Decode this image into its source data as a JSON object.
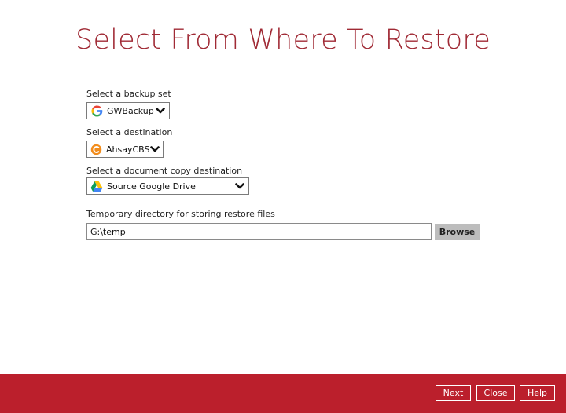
{
  "title": "Select From Where To Restore",
  "backup_set": {
    "label": "Select a backup set",
    "value": "GWBackup",
    "icon": "google-g-icon"
  },
  "destination": {
    "label": "Select a destination",
    "value": "AhsayCBS",
    "icon": "ahsay-icon"
  },
  "copy_destination": {
    "label": "Select a document copy destination",
    "value": "Source Google Drive",
    "icon": "google-drive-icon"
  },
  "temp_dir": {
    "label": "Temporary directory for storing restore files",
    "value": "G:\\temp",
    "browse_label": "Browse"
  },
  "footer": {
    "next_label": "Next",
    "close_label": "Close",
    "help_label": "Help"
  },
  "colors": {
    "accent": "#bb1f2c",
    "title": "#a02a35"
  }
}
